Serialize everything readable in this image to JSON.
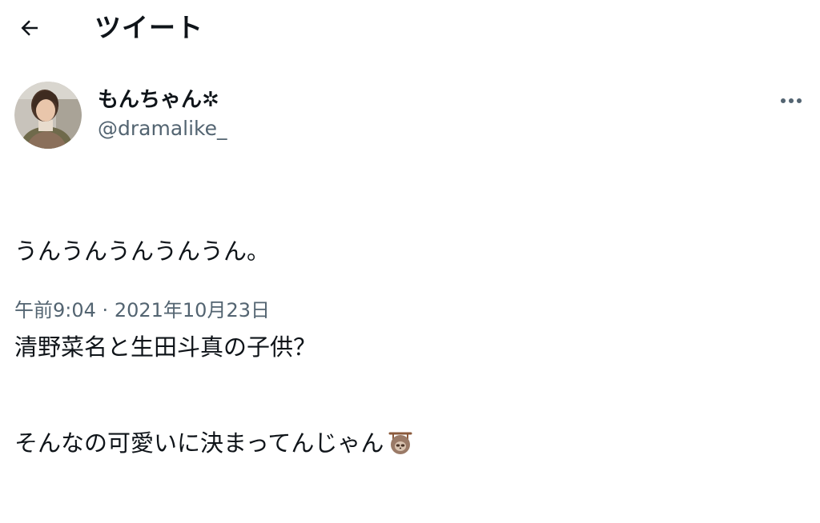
{
  "header": {
    "back_icon": "arrow-left-icon",
    "title": "ツイート"
  },
  "tweet": {
    "display_name": "もんちゃん✲",
    "handle": "@dramalike_",
    "more_icon": "more-horizontal-icon",
    "text_lines": [
      "うんうんうんうんうん。",
      "清野菜名と生田斗真の子供？",
      "そんなの可愛いに決まってんじゃん"
    ],
    "emoji": "sloth-icon",
    "time": "午前9:04",
    "separator": "·",
    "date": "2021年10月23日"
  },
  "colors": {
    "text_primary": "#0f1419",
    "text_secondary": "#536471",
    "background": "#ffffff"
  }
}
